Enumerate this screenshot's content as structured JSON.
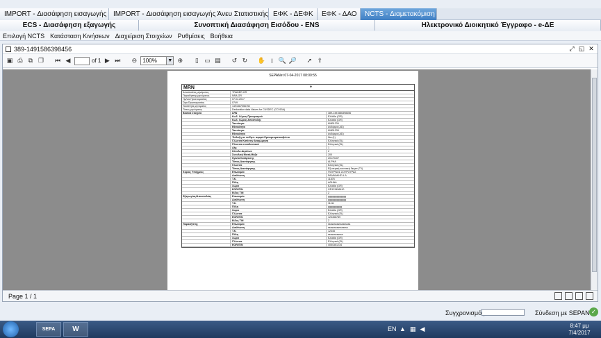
{
  "tabs_top": [
    {
      "label": "IMPORT - Διασάφηση εισαγωγής",
      "active": false
    },
    {
      "label": "IMPORT - Διασάφηση εισαγωγής Άνευ Στατιστικής",
      "active": false
    },
    {
      "label": "ΕΦΚ - ΔΕΦΚ",
      "active": false
    },
    {
      "label": "ΕΦΚ - ΔΑΟ",
      "active": false
    },
    {
      "label": "NCTS - Διαμετακόμιση",
      "active": true
    }
  ],
  "tabs_second": [
    {
      "label": "ECS - Διασάφηση εξαγωγής"
    },
    {
      "label": "Συνοπτική Διασάφηση Εισόδου - ENS"
    },
    {
      "label": "Ηλεκτρονικό Διοικητικό Έγγραφο - e-ΔΕ"
    }
  ],
  "menu": [
    "Επιλογή NCTS",
    "Κατάσταση Κινήσεων",
    "Διαχείριση Στοιχείων",
    "Ρυθμίσεις",
    "Βοήθεια"
  ],
  "document": {
    "title": "389-1491586398456",
    "toolbar": {
      "page_of": "of 1",
      "zoom": "100%"
    },
    "page_header": "SEPANet 07-04-2017 08:00:55",
    "mrn_label": "MRN",
    "mrn_plus": "+",
    "rows": [
      {
        "c1": "Αποστολέας μηνύματος",
        "c2": "TRADER.GR"
      },
      {
        "c1": "Παραλήπτης μηνύματος",
        "c2": "NRA.GR"
      },
      {
        "c1": "Ημ/νία Προετοιμασίας",
        "c2": "07.04.2017"
      },
      {
        "c1": "Ώρα Προετοιμασίας",
        "c2": "0749"
      },
      {
        "c1": "Ταυτότητα μηνύματος",
        "c2": "1491587056752"
      },
      {
        "c1": "Τύπος μηνύματος",
        "c2": "Declaration data Values for CUSDEC (CC015A)"
      }
    ],
    "section_basic": {
      "label": "Βασικά Στοιχεία",
      "rows": [
        {
          "k": "LRN",
          "v": "389-1491586398456"
        },
        {
          "k": "Κωδ. Χώρας Προορισμού",
          "v": "Ελλάδα (GR)"
        },
        {
          "k": "Κωδ. Χώρας Αποστολής",
          "v": "Ελλάδα (GR)"
        },
        {
          "k": "Ταυτότητα",
          "v": "KMB1234"
        },
        {
          "k": "Εθνικότητα",
          "v": "Ανδόρρα (AD)"
        },
        {
          "k": "Ταυτότητα",
          "v": "KMB1235"
        },
        {
          "k": "Εθνικότητα",
          "v": "Ανδόρρα (AD)"
        },
        {
          "k": "Ένδειξη αν τα Εμπ. αφορά Εμπορευματοκιβώτιο",
          "v": "Ναι (1)"
        },
        {
          "k": "Γλώσσα Κατά την Αναχώρηση",
          "v": "Ελληνικά (EL)"
        },
        {
          "k": "Γλώσσα συνοδευτικού",
          "v": "Ελληνικά (EL)"
        },
        {
          "k": "Δέμ.",
          "v": "1"
        },
        {
          "k": "Σύνολο Δεμάτων",
          "v": "2"
        },
        {
          "k": "Συνολική Μικτή Μάζα",
          "v": "200"
        },
        {
          "k": "Ημ/νία Κατάρτισης",
          "v": "20170407"
        },
        {
          "k": "Τόπος Διασάφησης",
          "v": "ALPHA"
        },
        {
          "k": "Γλώσσα",
          "v": "Ελληνικά (EL)"
        },
        {
          "k": "Τύπος Διασάφησης",
          "v": "Εξωτερική κοινοτική διαμετ.(T1)"
        }
      ]
    },
    "section_principal": {
      "label": "Κύριος Υπόχρεος",
      "rows": [
        {
          "k": "Επωνυμία",
          "v": "ΦΟΥΡΝΟΣ ΣΟΥΡΟΥΡΑΣ"
        },
        {
          "k": "Διεύθυνση",
          "v": "ΡΑΔΙΝΑΚΗΣ Α.Δ"
        },
        {
          "k": "Τ.Κ.",
          "v": "11876"
        },
        {
          "k": "Πόλη",
          "v": "ΑΘΗΝΑ"
        },
        {
          "k": "Χώρα",
          "v": "Ελλάδα (GR)"
        },
        {
          "k": "EORI/TIN",
          "v": "GR123456610"
        },
        {
          "k": "Ειδος TIN",
          "v": "2"
        }
      ]
    },
    "section_consignor": {
      "label": "Εξαγωγέας/Αποστολέας",
      "rows": [
        {
          "k": "Επωνυμία",
          "v": "ggggggggggggg"
        },
        {
          "k": "Διεύθυνση",
          "v": "ggggggggggggg"
        },
        {
          "k": "Τ.Κ.",
          "v": "11111"
        },
        {
          "k": "Πόλη",
          "v": "gggggggggg"
        },
        {
          "k": "Χώρα",
          "v": "Ελλάδα (GR)"
        },
        {
          "k": "Γλώσσα",
          "v": "Ελληνικά (EL)"
        },
        {
          "k": "EORI/TIN",
          "v": "123456789"
        },
        {
          "k": "Ειδος TIN",
          "v": "2"
        }
      ]
    },
    "section_consignee": {
      "label": "Παραλήπτης",
      "rows": [
        {
          "k": "Επωνυμία",
          "v": "ssssssssssssssssss"
        },
        {
          "k": "Διεύθυνση",
          "v": "ssssssssssssssss"
        },
        {
          "k": "Τ.Κ.",
          "v": "12345"
        },
        {
          "k": "Πόλη",
          "v": "ssssssssssss"
        },
        {
          "k": "Χώρα",
          "v": "Ελλάδα (GR)"
        },
        {
          "k": "Γλώσσα",
          "v": "Ελληνικά (EL)"
        },
        {
          "k": "EORI/TIN",
          "v": "405/28/1234"
        }
      ]
    },
    "status_page": "Page 1 / 1"
  },
  "app_status": {
    "sync_label": "Συγχρονισμός",
    "connection_label": "Σύνδεση με SEPANet"
  },
  "taskbar": {
    "app1": "SEPA",
    "app2": "W",
    "lang": "EN",
    "time": "8:47 μμ",
    "date": "7/4/2017"
  }
}
